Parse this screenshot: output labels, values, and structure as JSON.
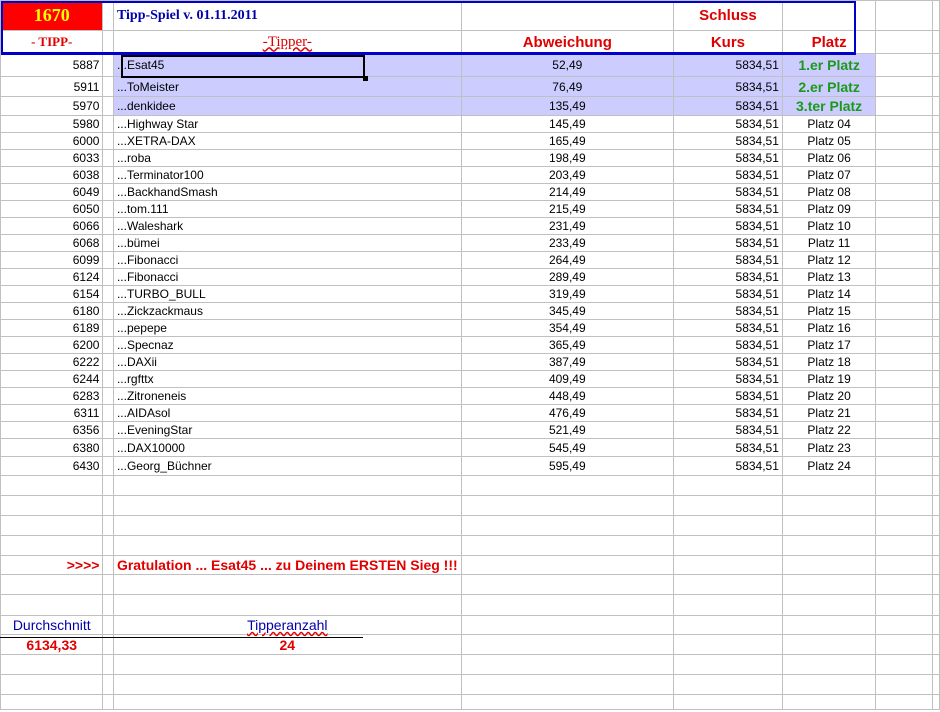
{
  "header": {
    "number": "1670",
    "title": "Tipp-Spiel v. 01.11.2011",
    "schluss": "Schluss",
    "col_tipp": "- TIPP-",
    "col_tipper": "-Tipper-",
    "col_abweichung": "Abweichung",
    "col_kurs": "Kurs",
    "col_platz": "Platz"
  },
  "rows": [
    [
      "5887",
      "...Esat45",
      "52,49",
      "5834,51",
      "1.er Platz"
    ],
    [
      "5911",
      "...ToMeister",
      "76,49",
      "5834,51",
      "2.er Platz"
    ],
    [
      "5970",
      "...denkidee",
      "135,49",
      "5834,51",
      "3.ter Platz"
    ],
    [
      "5980",
      "...Highway Star",
      "145,49",
      "5834,51",
      "Platz 04"
    ],
    [
      "6000",
      "...XETRA-DAX",
      "165,49",
      "5834,51",
      "Platz 05"
    ],
    [
      "6033",
      "...roba",
      "198,49",
      "5834,51",
      "Platz 06"
    ],
    [
      "6038",
      "...Terminator100",
      "203,49",
      "5834,51",
      "Platz 07"
    ],
    [
      "6049",
      "...BackhandSmash",
      "214,49",
      "5834,51",
      "Platz 08"
    ],
    [
      "6050",
      "...tom.111",
      "215,49",
      "5834,51",
      "Platz 09"
    ],
    [
      "6066",
      "...Waleshark",
      "231,49",
      "5834,51",
      "Platz 10"
    ],
    [
      "6068",
      "...bümei",
      "233,49",
      "5834,51",
      "Platz 11"
    ],
    [
      "6099",
      "...Fibonacci",
      "264,49",
      "5834,51",
      "Platz 12"
    ],
    [
      "6124",
      "...Fibonacci",
      "289,49",
      "5834,51",
      "Platz 13"
    ],
    [
      "6154",
      "...TURBO_BULL",
      "319,49",
      "5834,51",
      "Platz 14"
    ],
    [
      "6180",
      "...Zickzackmaus",
      "345,49",
      "5834,51",
      "Platz 15"
    ],
    [
      "6189",
      "...pepepe",
      "354,49",
      "5834,51",
      "Platz 16"
    ],
    [
      "6200",
      "...Specnaz",
      "365,49",
      "5834,51",
      "Platz 17"
    ],
    [
      "6222",
      "...DAXii",
      "387,49",
      "5834,51",
      "Platz 18"
    ],
    [
      "6244",
      "...rgfttx",
      "409,49",
      "5834,51",
      "Platz 19"
    ],
    [
      "6283",
      "...Zitroneneis",
      "448,49",
      "5834,51",
      "Platz 20"
    ],
    [
      "6311",
      "...AIDAsol",
      "476,49",
      "5834,51",
      "Platz 21"
    ],
    [
      "6356",
      "...EveningStar",
      "521,49",
      "5834,51",
      "Platz 22"
    ],
    [
      "6380",
      "...DAX10000",
      "545,49",
      "5834,51",
      "Platz 23"
    ],
    [
      "6430",
      "...Georg_Büchner",
      "595,49",
      "5834,51",
      "Platz 24"
    ]
  ],
  "footer": {
    "arrows": ">>>>",
    "congrats": "Gratulation ... Esat45 ... zu Deinem ERSTEN Sieg !!!",
    "avg_label": "Durchschnitt",
    "avg_value": "6134,33",
    "count_label": "Tipperanzahl",
    "count_value": "24"
  }
}
